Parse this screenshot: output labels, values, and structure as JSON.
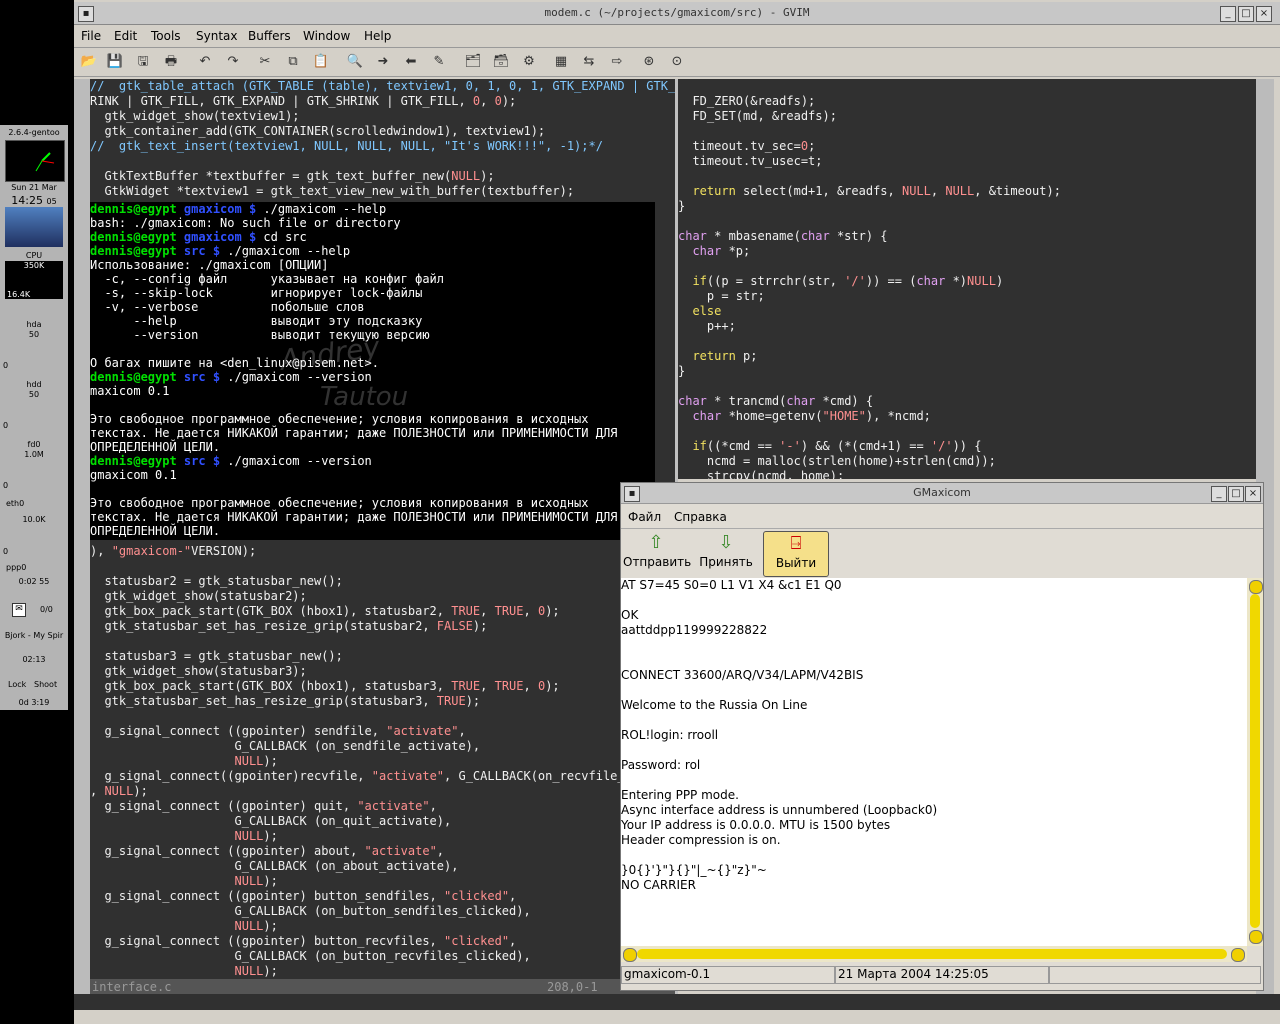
{
  "gvim": {
    "title": "modem.c (~/projects/gmaxicom/src) - GVIM",
    "menu": [
      "File",
      "Edit",
      "Tools",
      "Syntax",
      "Buffers",
      "Window",
      "Help"
    ],
    "status_file": "interface.c",
    "status_pos": "208,0-1"
  },
  "left_code": [
    "//  gtk_table_attach (GTK_TABLE (table), textview1, 0, 1, 0, 1, GTK_EXPAND | GTK_SH",
    "RINK | GTK_FILL, GTK_EXPAND | GTK_SHRINK | GTK_FILL, 0, 0);",
    "  gtk_widget_show(textview1);",
    "  gtk_container_add(GTK_CONTAINER(scrolledwindow1), textview1);",
    "//  gtk_text_insert(textview1, NULL, NULL, NULL, \"It's WORK!!!\", -1);*/",
    "",
    "  GtkTextBuffer *textbuffer = gtk_text_buffer_new(NULL);",
    "  GtkWidget *textview1 = gtk_text_view_new_with_buffer(textbuffer);"
  ],
  "left_code_lower": [
    "), \"gmaxicom-\"VERSION);",
    "",
    "  statusbar2 = gtk_statusbar_new();",
    "  gtk_widget_show(statusbar2);",
    "  gtk_box_pack_start(GTK_BOX (hbox1), statusbar2, TRUE, TRUE, 0);",
    "  gtk_statusbar_set_has_resize_grip(statusbar2, FALSE);",
    "",
    "  statusbar3 = gtk_statusbar_new();",
    "  gtk_widget_show(statusbar3);",
    "  gtk_box_pack_start(GTK_BOX (hbox1), statusbar3, TRUE, TRUE, 0);",
    "  gtk_statusbar_set_has_resize_grip(statusbar3, TRUE);",
    "",
    "  g_signal_connect ((gpointer) sendfile, \"activate\",",
    "                    G_CALLBACK (on_sendfile_activate),",
    "                    NULL);",
    "  g_signal_connect((gpointer)recvfile, \"activate\", G_CALLBACK(on_recvfile_ac",
    ", NULL);",
    "  g_signal_connect ((gpointer) quit, \"activate\",",
    "                    G_CALLBACK (on_quit_activate),",
    "                    NULL);",
    "  g_signal_connect ((gpointer) about, \"activate\",",
    "                    G_CALLBACK (on_about_activate),",
    "                    NULL);",
    "  g_signal_connect ((gpointer) button_sendfiles, \"clicked\",",
    "                    G_CALLBACK (on_button_sendfiles_clicked),",
    "                    NULL);",
    "  g_signal_connect ((gpointer) button_recvfiles, \"clicked\",",
    "                    G_CALLBACK (on_button_recvfiles_clicked),",
    "                    NULL);"
  ],
  "right_code": [
    "",
    "  FD_ZERO(&readfs);",
    "  FD_SET(md, &readfs);",
    "",
    "  timeout.tv_sec=0;",
    "  timeout.tv_usec=t;",
    "",
    "  return select(md+1, &readfs, NULL, NULL, &timeout);",
    "}",
    "",
    "char * mbasename(char *str) {",
    "  char *p;",
    "",
    "  if((p = strrchr(str, '/')) == (char *)NULL)",
    "    p = str;",
    "  else",
    "    p++;",
    "",
    "  return p;",
    "}",
    "",
    "char * trancmd(char *cmd) {",
    "  char *home=getenv(\"HOME\"), *ncmd;",
    "",
    "  if((*cmd == '-') && (*(cmd+1) == '/')) {",
    "    ncmd = malloc(strlen(home)+strlen(cmd));",
    "    strcpy(ncmd, home);"
  ],
  "terminal": {
    "lines": [
      {
        "u": "dennis@egypt",
        "d": "gmaxicom $",
        "t": " ./gmaxicom --help"
      },
      {
        "t": "bash: ./gmaxicom: No such file or directory"
      },
      {
        "u": "dennis@egypt",
        "d": "gmaxicom $",
        "t": " cd src"
      },
      {
        "u": "dennis@egypt",
        "d": "src $",
        "t": " ./gmaxicom --help"
      },
      {
        "t": "Использование: ./gmaxicom [ОПЦИИ]"
      },
      {
        "t": "  -c, --config файл      указывает на конфиг файл"
      },
      {
        "t": "  -s, --skip-lock        игнорирует lock-файлы"
      },
      {
        "t": "  -v, --verbose          побольше слов"
      },
      {
        "t": "      --help             выводит эту подсказку"
      },
      {
        "t": "      --version          выводит текущую версию"
      },
      {
        "t": ""
      },
      {
        "t": "О багах пишите на <den_linux@pisem.net>."
      },
      {
        "u": "dennis@egypt",
        "d": "src $",
        "t": " ./gmaxicom --version"
      },
      {
        "t": "maxicom 0.1"
      },
      {
        "t": ""
      },
      {
        "t": "Это свободное программное обеспечение; условия копирования в исходных"
      },
      {
        "t": "текстах. Не дается НИКАКОЙ гарантии; даже ПОЛЕЗНОСТИ или ПРИМЕНИМОСТИ ДЛЯ"
      },
      {
        "t": "ОПРЕДЕЛЕННОЙ ЦЕЛИ."
      },
      {
        "u": "dennis@egypt",
        "d": "src $",
        "t": " ./gmaxicom --version"
      },
      {
        "t": "gmaxicom 0.1"
      },
      {
        "t": ""
      },
      {
        "t": "Это свободное программное обеспечение; условия копирования в исходных"
      },
      {
        "t": "текстах. Не дается НИКАКОЙ гарантии; даже ПОЛЕЗНОСТИ или ПРИМЕНИМОСТИ ДЛЯ"
      },
      {
        "t": "ОПРЕДЕЛЕННОЙ ЦЕЛИ."
      }
    ]
  },
  "dock": {
    "kernel": "2.6.4-gentoo",
    "date": "Sun 21 Mar",
    "time": "14:25",
    "seconds": "05",
    "cpu_label": "CPU",
    "cpu_val": "350K",
    "mem_val": "16.4K",
    "hda": "hda",
    "hda_val": "50",
    "hdd": "hdd",
    "hdd_val": "50",
    "fd0": "fd0",
    "fd0_val": "1.0M",
    "eth0": "eth0",
    "eth0_val": "10.0K",
    "ppp0": "ppp0",
    "ppp_time": "0:02 55",
    "mail": "0/0",
    "player": "Bjork - My Spir",
    "player_time": "02:13",
    "lock": "Lock",
    "shoot": "Shoot",
    "uptime": "0d 3:19",
    "zero1": "0",
    "zero2": "0",
    "zero3": "0",
    "zero4": "0"
  },
  "gmaxicom": {
    "title": "GMaxicom",
    "menu": [
      "Файл",
      "Справка"
    ],
    "buttons": [
      "Отправить",
      "Принять",
      "Выйти"
    ],
    "text": [
      "AT S7=45 S0=0 L1 V1 X4 &c1 E1 Q0",
      "",
      "OK",
      "aattddpp119999228822",
      "",
      "",
      "CONNECT 33600/ARQ/V34/LAPM/V42BIS",
      "",
      "Welcome to the Russia On Line",
      "",
      "ROL!login: rrooll",
      "",
      "Password: rol",
      "",
      "Entering PPP mode.",
      "Async interface address is unnumbered (Loopback0)",
      "Your IP address is 0.0.0.0. MTU is 1500 bytes",
      "Header compression is on.",
      "",
      "}0{}'}\"}{}\"|_~{}\"z}\"~",
      "NO CARRIER"
    ],
    "status_version": "gmaxicom-0.1",
    "status_date": "21 Марта 2004 14:25:05"
  },
  "watermark": [
    "Andrey",
    "Tautou"
  ]
}
